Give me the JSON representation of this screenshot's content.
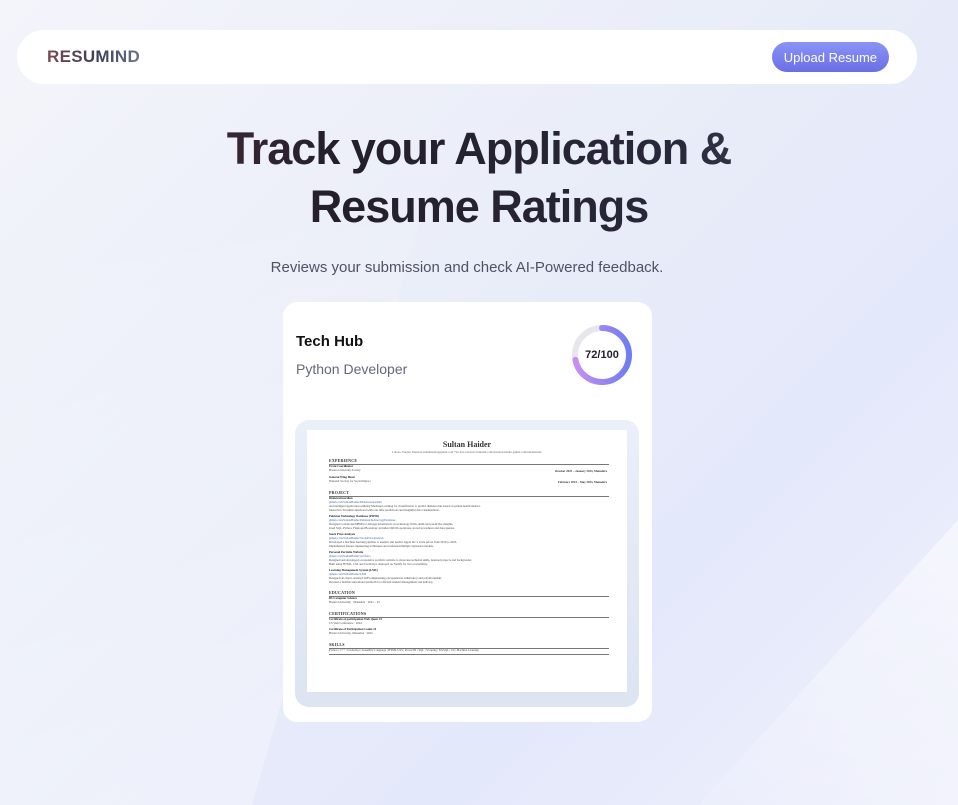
{
  "nav": {
    "logo": "RESUMIND",
    "upload_label": "Upload Resume"
  },
  "hero": {
    "title_line1": "Track your Application &",
    "title_line2": "Resume Ratings",
    "subtitle": "Reviews your submission and check AI-Powered feedback."
  },
  "card": {
    "company": "Tech Hub",
    "role": "Python Developer",
    "score": 72,
    "score_max": 100,
    "score_text": "72/100",
    "ring_color_start": "#c98ff0",
    "ring_color_end": "#6f7df2",
    "ring_track_color": "#e6e6ec"
  },
  "resume": {
    "name": "Sultan Haider",
    "contact": "Lahore, Punjab, Pakistan   sultanhaider@gmail.com   +92-3xx-xxxxxxx   linkedin.com/in/sultan-haider   github.com/sultanhaider",
    "sections": {
      "experience": "EXPERIENCE",
      "project": "PROJECT",
      "education": "EDUCATION",
      "certifications": "CERTIFICATIONS",
      "skills": "SKILLS"
    },
    "experience": [
      {
        "title": "Event Coordinator",
        "org": "Hazara University Society",
        "dates": "October 2023 – January 2024,  Mansehra"
      },
      {
        "title": "General Wing Head",
        "org": "National Society for Social Impact",
        "dates": "February 2023 – May 2023,  Mansehra"
      }
    ],
    "projects": [
      {
        "title": "DiabetesGuardian",
        "link": "github.com/SultanHaider/DiabetesGuardian",
        "desc": [
          "An intelligent application utilizing Machine Learning for classification to predict diabetes risk based on patient health metrics.",
          "Interactive Streamlit dashboard with real-time predictions and insightful data visualizations."
        ]
      },
      {
        "title": "Pakistan Technology Database (PSHD)",
        "link": "github.com/SultanHaider/PakistanTechnologyDatabase",
        "desc": [
          "Designed a relational DBMS to manage information on technology firms, skills and predictive insights.",
          "Used SQL, Python, Flask and Bootstrap; includes CRUD operations, stored procedures and data queries."
        ]
      },
      {
        "title": "Stock Price Analysis",
        "link": "github.com/SultanHaider/StockPriceAnalysis",
        "desc": [
          "Developed a machine learning pipeline to analyze and predict Apple Inc.'s stock prices from 2010 to 2023.",
          "Implemented feature engineering techniques and evaluated multiple regression models."
        ]
      },
      {
        "title": "Personal Portfolio Website",
        "link": "github.com/SultanHaider/portfolio",
        "desc": [
          "Designed and developed a responsive portfolio website to showcase technical skills, featured projects and background.",
          "Built using HTML, CSS and JavaScript, deployed on Netlify for live accessibility."
        ]
      },
      {
        "title": "Learning Management System (LMS)",
        "link": "github.com/SultanHaider/LMS",
        "desc": [
          "Designed an object-oriented LMS emphasizing encapsulation, inheritance and polymorphism.",
          "Devised a flexible educational platform for efficient student management and delivery."
        ]
      }
    ],
    "education": {
      "degree": "BS Computer Science",
      "school": "Hazara University  ·  Mansehra  ·  2021 – 25"
    },
    "certs": [
      {
        "title": "Certificate of participation Web Quest 24",
        "org": "CS Web Conference  ·  2024"
      },
      {
        "title": "Certificate of Participation Codex 24",
        "org": "Hazara University, Mansehra  ·  2024"
      }
    ],
    "skills": "Python  |  C++  |  JavaScript  |  Assembly Language  |  HTML/CSS  |  Power BI  |  SQL  |  Scraping  |  MySQL  |  Git  |  Machine Learning"
  }
}
